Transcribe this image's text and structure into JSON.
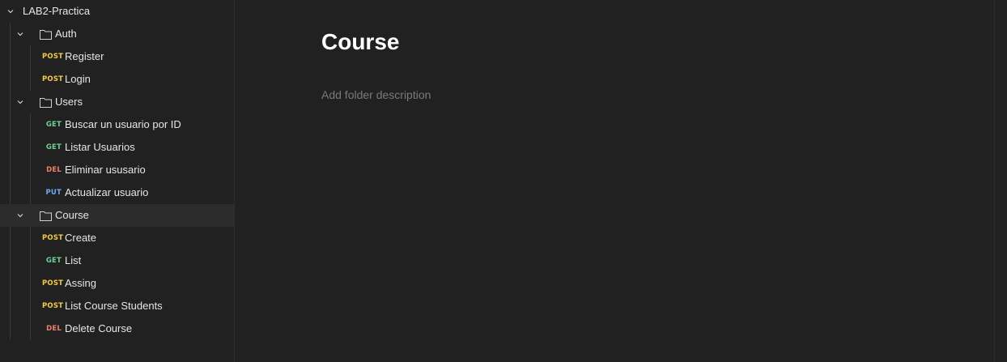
{
  "collection": {
    "name": "LAB2-Practica"
  },
  "folders": {
    "auth": {
      "name": "Auth",
      "requests": [
        {
          "method": "POST",
          "name": "Register"
        },
        {
          "method": "POST",
          "name": "Login"
        }
      ]
    },
    "users": {
      "name": "Users",
      "requests": [
        {
          "method": "GET",
          "name": "Buscar un usuario por ID"
        },
        {
          "method": "GET",
          "name": "Listar Usuarios"
        },
        {
          "method": "DEL",
          "name": "Eliminar ususario"
        },
        {
          "method": "PUT",
          "name": "Actualizar usuario"
        }
      ]
    },
    "course": {
      "name": "Course",
      "requests": [
        {
          "method": "POST",
          "name": "Create"
        },
        {
          "method": "GET",
          "name": "List"
        },
        {
          "method": "POST",
          "name": "Assing"
        },
        {
          "method": "POST",
          "name": "List Course Students"
        },
        {
          "method": "DEL",
          "name": "Delete Course"
        }
      ]
    }
  },
  "main": {
    "title": "Course",
    "description_placeholder": "Add folder description"
  },
  "colors": {
    "background": "#212121",
    "post": "#f2c94c",
    "get": "#6fcf97",
    "del": "#eb7f70",
    "put": "#6ea8f2"
  }
}
